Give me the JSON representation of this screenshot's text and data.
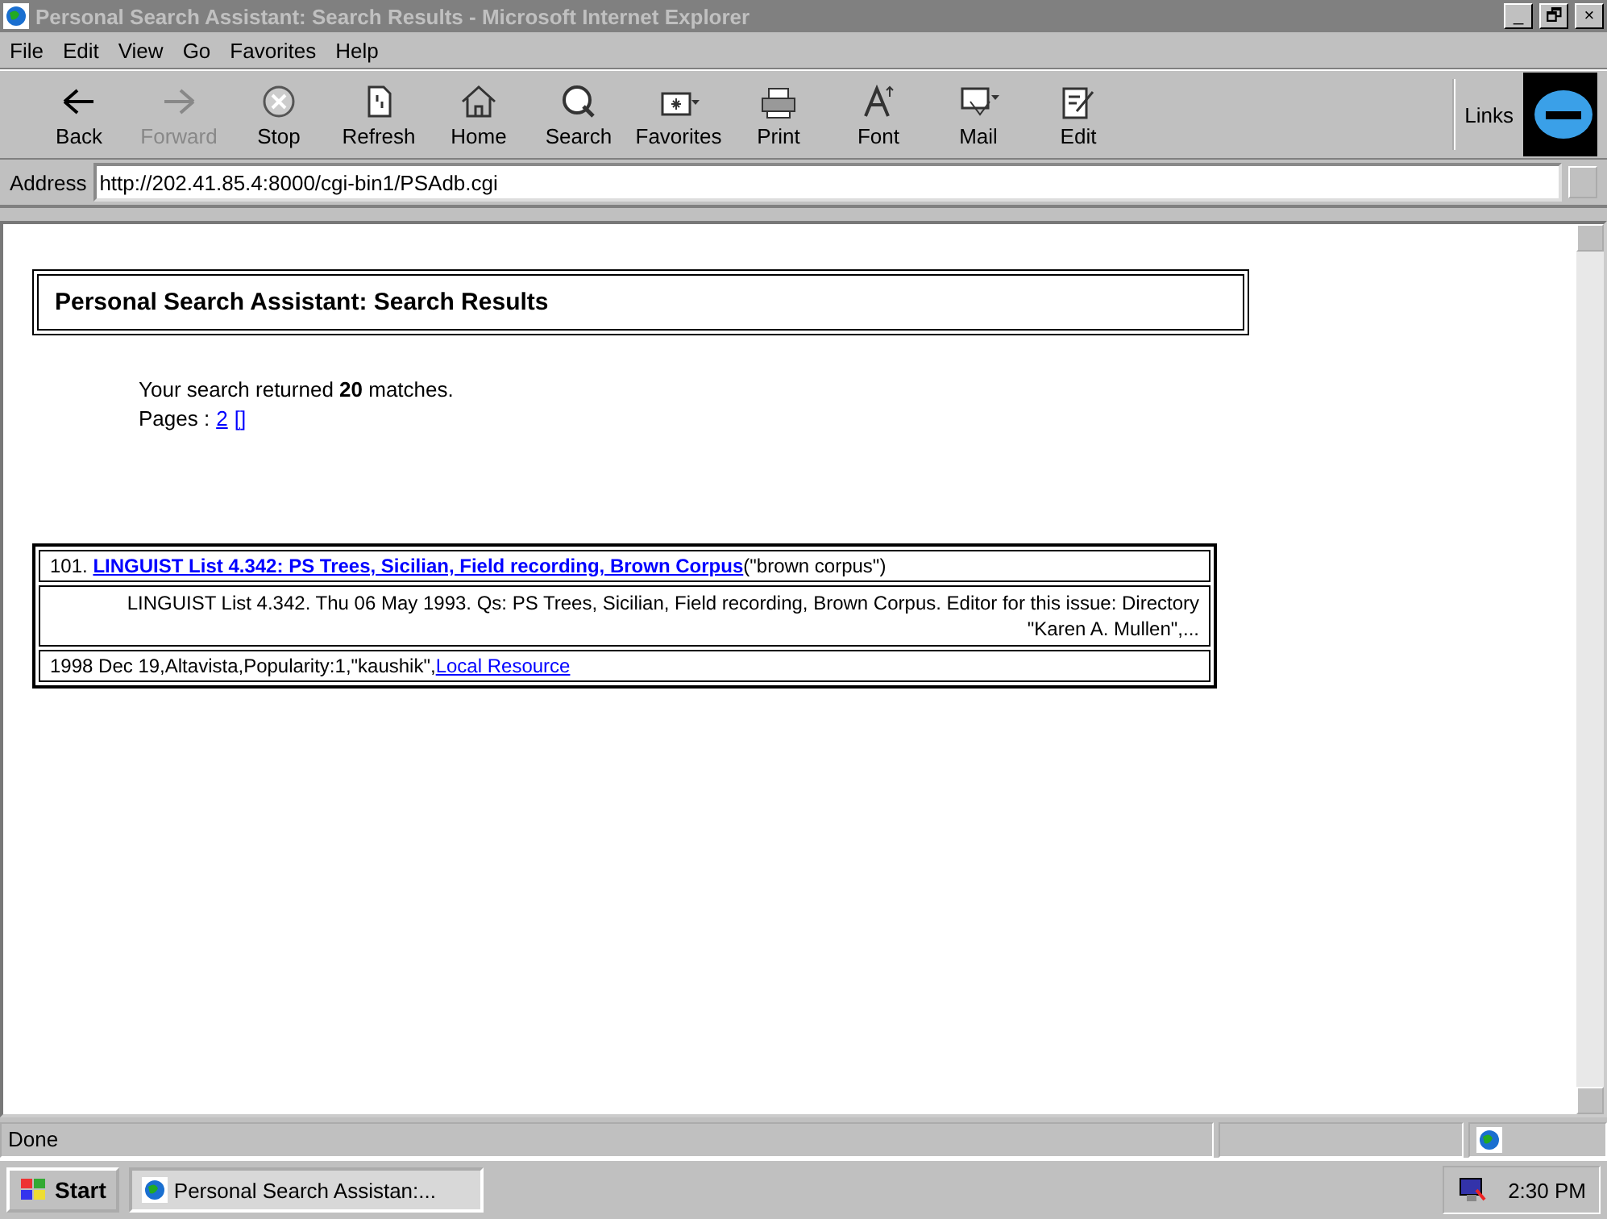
{
  "window": {
    "title": "Personal Search Assistant: Search Results - Microsoft Internet Explorer",
    "controls": [
      "_",
      "🗗",
      "×"
    ]
  },
  "menu": [
    "File",
    "Edit",
    "View",
    "Go",
    "Favorites",
    "Help"
  ],
  "toolbar": [
    {
      "label": "Back",
      "disabled": false
    },
    {
      "label": "Forward",
      "disabled": true
    },
    {
      "label": "Stop",
      "disabled": false
    },
    {
      "label": "Refresh",
      "disabled": false
    },
    {
      "label": "Home",
      "disabled": false
    },
    {
      "label": "Search",
      "disabled": false
    },
    {
      "label": "Favorites",
      "disabled": false
    },
    {
      "label": "Print",
      "disabled": false
    },
    {
      "label": "Font",
      "disabled": false
    },
    {
      "label": "Mail",
      "disabled": false
    },
    {
      "label": "Edit",
      "disabled": false
    }
  ],
  "links_label": "Links",
  "address": {
    "label": "Address",
    "value": "http://202.41.85.4:8000/cgi-bin1/PSAdb.cgi"
  },
  "page": {
    "heading": "Personal Search Assistant: Search Results",
    "summary": "Your search returned **20** matches.",
    "pages_label": "Pages : ",
    "page_links": [
      "2",
      "[]"
    ],
    "results": [
      {
        "number": "101.",
        "title": "LINGUIST List 4.342: PS Trees, Sicilian, Field recording, Brown Corpus",
        "query": "(\"brown corpus\")",
        "snippet": "LINGUIST List 4.342. Thu 06 May 1993. Qs: PS Trees, Sicilian, Field recording, Brown Corpus. Editor for this issue: Directory \"Karen A. Mullen\",...",
        "meta": "1998 Dec 19,Altavista,Popularity:1,\"kaushik\",",
        "resource_link": "Local Resource"
      }
    ]
  },
  "status_bar": {
    "text": "Done"
  },
  "taskbar": {
    "start": "Start",
    "tasks": [
      "Personal Search Assistan:..."
    ],
    "clock": "2:30 PM"
  }
}
